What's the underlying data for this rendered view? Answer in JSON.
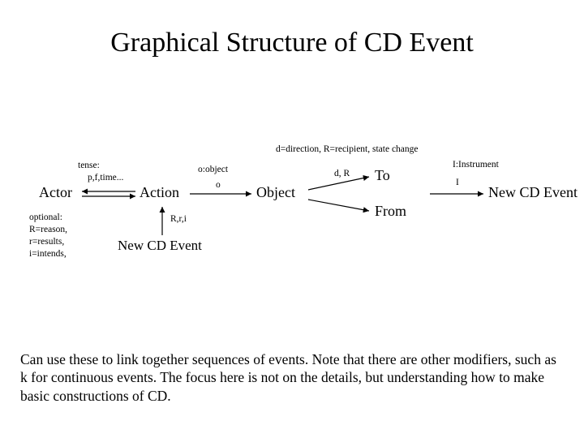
{
  "title": "Graphical Structure of CD Event",
  "nodes": {
    "actor": "Actor",
    "action": "Action",
    "object": "Object",
    "to": "To",
    "from": "From",
    "newcd1": "New CD Event",
    "newcd2": "New CD Event"
  },
  "labels": {
    "tense": "tense:",
    "pftime": "p,f,time...",
    "o_object": "o:object",
    "o": "o",
    "dR": "d, R",
    "d_direction": "d=direction, R=recipient, state change",
    "I_instr": "I:Instrument",
    "I": "I",
    "Rri": "R,r,i",
    "optional": "optional:",
    "Rreason": "R=reason,",
    "rresults": "r=results,",
    "iintends": "i=intends,"
  },
  "footer": "Can use these to link together sequences of events.  Note that there are other modifiers, such as k for continuous events.  The focus here is not on the details, but understanding how to make basic constructions of CD."
}
